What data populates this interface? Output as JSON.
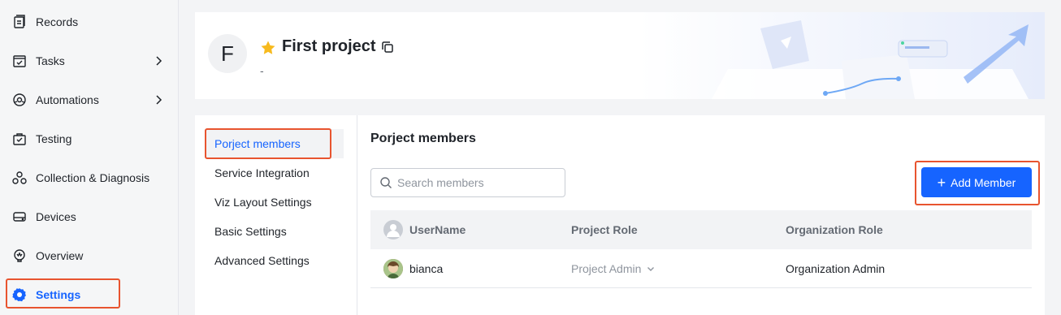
{
  "sidebar": {
    "items": [
      {
        "label": "Records",
        "icon": "records-icon"
      },
      {
        "label": "Tasks",
        "icon": "tasks-icon"
      },
      {
        "label": "Automations",
        "icon": "automations-icon"
      },
      {
        "label": "Testing",
        "icon": "testing-icon"
      },
      {
        "label": "Collection & Diagnosis",
        "icon": "collection-diagnosis-icon"
      },
      {
        "label": "Devices",
        "icon": "devices-icon"
      },
      {
        "label": "Overview",
        "icon": "overview-icon"
      },
      {
        "label": "Settings",
        "icon": "gear-icon"
      }
    ]
  },
  "project": {
    "avatar_letter": "F",
    "title": "First project",
    "description": "-"
  },
  "settings_nav": {
    "items": [
      {
        "label": "Porject members"
      },
      {
        "label": "Service Integration"
      },
      {
        "label": "Viz Layout Settings"
      },
      {
        "label": "Basic Settings"
      },
      {
        "label": "Advanced Settings"
      }
    ]
  },
  "members": {
    "title": "Porject members",
    "search_placeholder": "Search members",
    "add_label": "Add Member",
    "columns": [
      "UserName",
      "Project Role",
      "Organization Role"
    ],
    "rows": [
      {
        "username": "bianca",
        "project_role": "Project Admin",
        "organization_role": "Organization Admin"
      }
    ]
  },
  "colors": {
    "accent": "#1664ff",
    "highlight_border": "#e8542f",
    "star": "#f7ba1e"
  }
}
